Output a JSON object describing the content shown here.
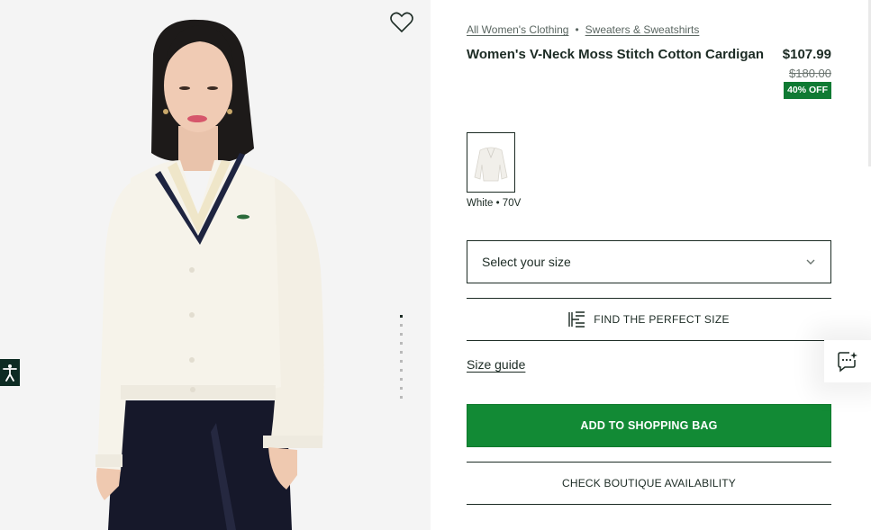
{
  "gallery": {
    "wishlist_icon": "heart-outline-icon",
    "dot_count": 10,
    "active_dot": 0,
    "accessibility_icon": "accessibility-icon",
    "colors": {
      "background": "#f4f4f4",
      "sweater": "#f6f3ea",
      "skirt": "#16182a",
      "trim": "#1e2440"
    }
  },
  "breadcrumb": {
    "items": [
      "All Women's Clothing",
      "Sweaters & Sweatshirts"
    ],
    "separator": "•"
  },
  "product": {
    "title": "Women's V-Neck Moss Stitch Cotton Cardigan",
    "price": "$107.99",
    "old_price": "$180.00",
    "discount": "40% OFF"
  },
  "color_option": {
    "label": "White • 70V",
    "selected": true
  },
  "size": {
    "placeholder": "Select your size",
    "chevron_icon": "chevron-down-icon"
  },
  "fit_finder": {
    "label": "FIND THE PERFECT SIZE",
    "icon": "fit-finder-logo-icon"
  },
  "size_guide": "Size guide",
  "actions": {
    "add_to_bag": "ADD TO SHOPPING BAG",
    "check_boutique": "CHECK BOUTIQUE AVAILABILITY"
  },
  "chat": {
    "icon": "chat-sparkle-icon"
  },
  "theme": {
    "accent_green": "#128a35",
    "discount_green": "#0f7a33",
    "text_dark": "#1c2b24",
    "a11y_bg": "#0d2b23"
  }
}
